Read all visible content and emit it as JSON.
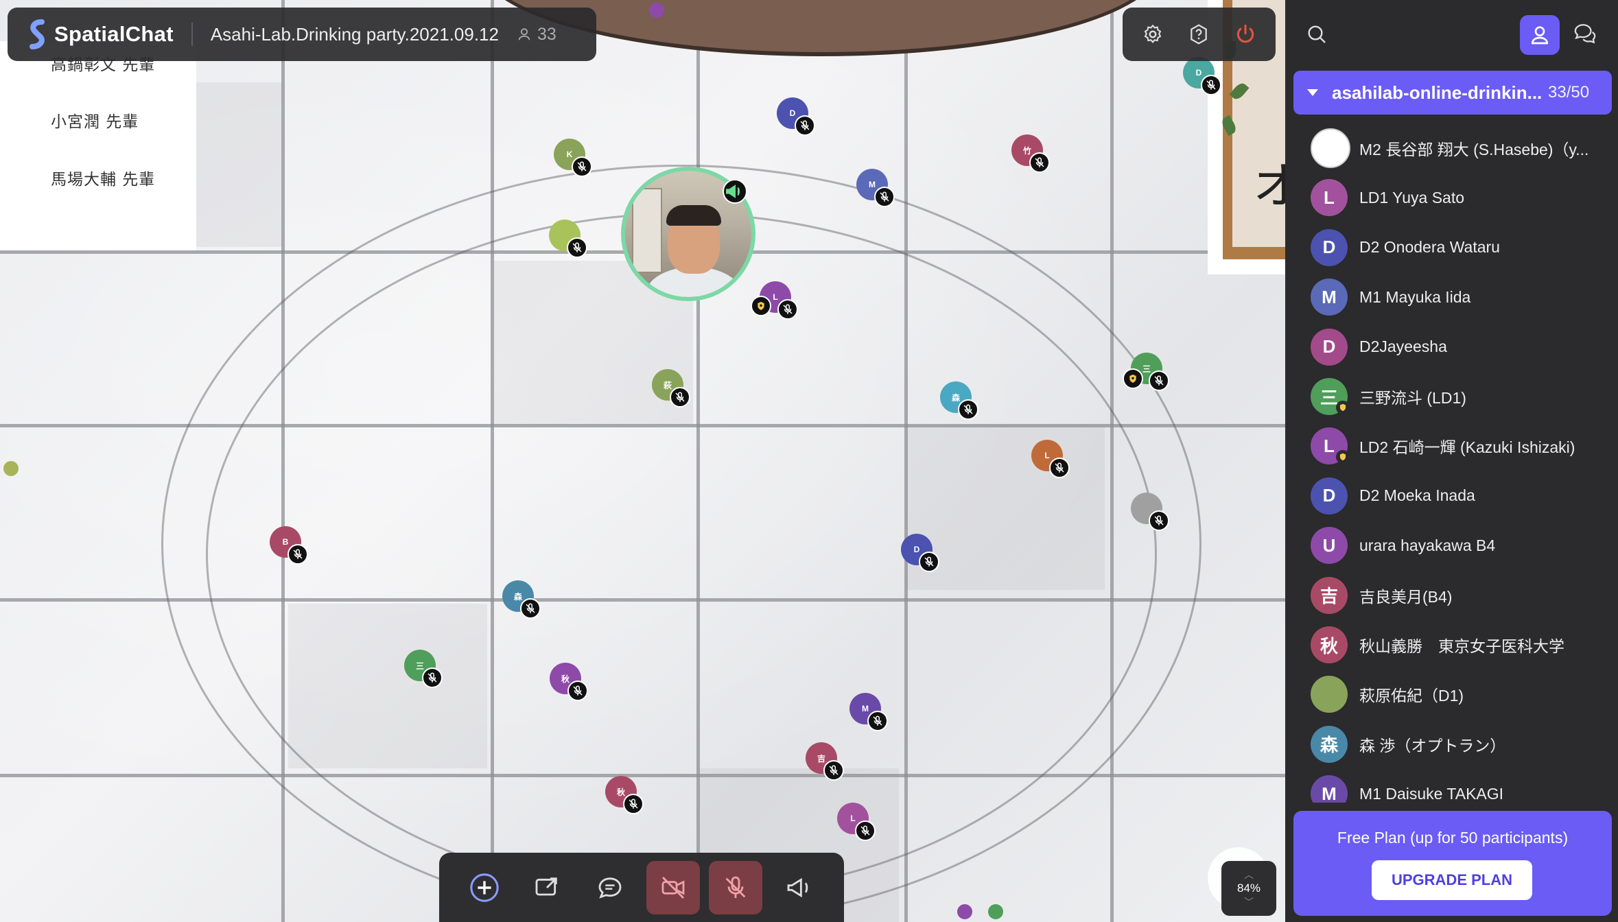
{
  "app": {
    "name": "SpatialChat",
    "room_title": "Asahi-Lab.Drinking party.2021.09.12",
    "participant_count": "33"
  },
  "board_names": [
    "高鍋彰文 先輩",
    "小宮潤 先輩",
    "馬場大輔 先輩"
  ],
  "frame_char": "オ",
  "toolbar": {
    "zoom_label": "84%"
  },
  "sidebar": {
    "room_name": "asahilab-online-drinkin...",
    "room_count": "33/50",
    "participants": [
      {
        "name": "M2 長谷部 翔大 (S.Hasebe)（y...",
        "initial": "",
        "color": "#ffffff",
        "badge": false
      },
      {
        "name": "LD1 Yuya Sato",
        "initial": "L",
        "color": "#a2529c",
        "badge": false
      },
      {
        "name": "D2 Onodera Wataru",
        "initial": "D",
        "color": "#4b52b0",
        "badge": false
      },
      {
        "name": "M1 Mayuka Iida",
        "initial": "M",
        "color": "#5a6ab8",
        "badge": false
      },
      {
        "name": "D2Jayeesha",
        "initial": "D",
        "color": "#a24a8a",
        "badge": false
      },
      {
        "name": "三野流斗 (LD1)",
        "initial": "三",
        "color": "#4f9e5a",
        "badge": true
      },
      {
        "name": "LD2 石崎一輝 (Kazuki Ishizaki)",
        "initial": "L",
        "color": "#8e4aa8",
        "badge": true
      },
      {
        "name": "D2 Moeka Inada",
        "initial": "D",
        "color": "#4b52b0",
        "badge": false
      },
      {
        "name": "urara hayakawa B4",
        "initial": "U",
        "color": "#8e4aa8",
        "badge": false
      },
      {
        "name": "吉良美月(B4)",
        "initial": "吉",
        "color": "#a84a66",
        "badge": false
      },
      {
        "name": "秋山義勝　東京女子医科大学",
        "initial": "秋",
        "color": "#a84a66",
        "badge": false
      },
      {
        "name": "萩原佑紀（D1)",
        "initial": "",
        "color": "#8aa35a",
        "badge": false
      },
      {
        "name": "森 渉（オプトラン）",
        "initial": "森",
        "color": "#4a88a8",
        "badge": false
      },
      {
        "name": "M1 Daisuke TAKAGI",
        "initial": "M",
        "color": "#6a4aa8",
        "badge": false
      }
    ],
    "plan_text": "Free Plan (up for 50 participants)",
    "upgrade_label": "UPGRADE PLAN"
  },
  "map_avatars": [
    {
      "initial": "D",
      "color": "#4b52b0"
    },
    {
      "initial": "K",
      "color": "#8aa35a"
    },
    {
      "initial": "竹",
      "color": "#a84a66"
    },
    {
      "initial": "M",
      "color": "#5a6ab8"
    },
    {
      "initial": "",
      "color": "#a8c35a"
    },
    {
      "initial": "L",
      "color": "#8e4aa8"
    },
    {
      "initial": "萩",
      "color": "#8aa35a"
    },
    {
      "initial": "三",
      "color": "#4f9e5a"
    },
    {
      "initial": "森",
      "color": "#4aa8c3"
    },
    {
      "initial": "L",
      "color": "#c06a3a"
    },
    {
      "initial": "B",
      "color": "#a84a66"
    },
    {
      "initial": "D",
      "color": "#4b52b0"
    },
    {
      "initial": "森",
      "color": "#4a88a8"
    },
    {
      "initial": "三",
      "color": "#4f9e5a"
    },
    {
      "initial": "秋",
      "color": "#8e4aa8"
    },
    {
      "initial": "M",
      "color": "#6a4aa8"
    },
    {
      "initial": "吉",
      "color": "#a84a66"
    },
    {
      "initial": "秋",
      "color": "#a84a66"
    },
    {
      "initial": "L",
      "color": "#a2529c"
    },
    {
      "initial": "D",
      "color": "#4aa8a0"
    },
    {
      "initial": "",
      "color": "#a0a0a0"
    }
  ],
  "colors": {
    "accent": "#6a5cf5",
    "speaker_ring": "#7cd8a6",
    "power": "#e5533d",
    "host_badge": "#f3c74d"
  },
  "icons": [
    "spatialchat-logo-icon",
    "user-icon",
    "gear-icon",
    "help-icon",
    "power-icon",
    "search-icon",
    "users-icon",
    "chat-icon",
    "add-icon",
    "share-screen-icon",
    "message-icon",
    "camera-off-icon",
    "mic-off-icon",
    "broadcast-icon",
    "megaphone-icon",
    "host-icon"
  ]
}
